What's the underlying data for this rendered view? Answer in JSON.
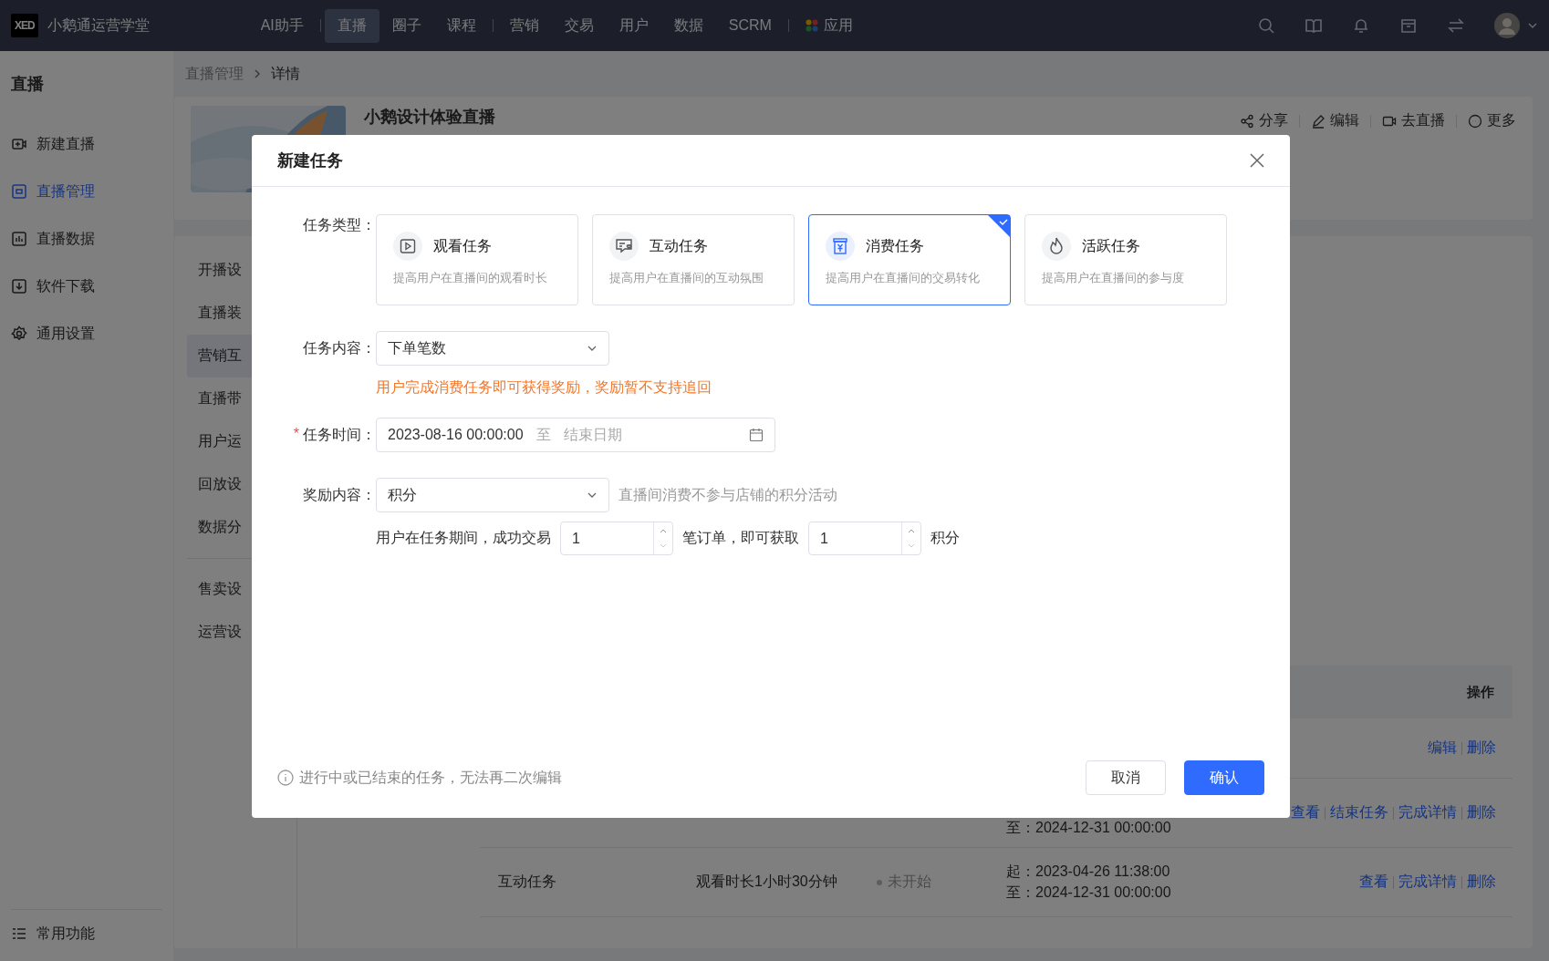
{
  "top_bar": {
    "logo": "XED",
    "brand": "小鹅通运营学堂",
    "nav_groups": [
      {
        "items": [
          {
            "label": "AI助手",
            "selected": false,
            "kind": "text"
          }
        ]
      },
      {
        "items": [
          {
            "label": "直播",
            "selected": true,
            "kind": "text"
          },
          {
            "label": "圈子",
            "selected": false,
            "kind": "text"
          },
          {
            "label": "课程",
            "selected": false,
            "kind": "text"
          }
        ]
      },
      {
        "items": [
          {
            "label": "营销",
            "selected": false,
            "kind": "text"
          },
          {
            "label": "交易",
            "selected": false,
            "kind": "text"
          },
          {
            "label": "用户",
            "selected": false,
            "kind": "text"
          },
          {
            "label": "数据",
            "selected": false,
            "kind": "text"
          },
          {
            "label": "SCRM",
            "selected": false,
            "kind": "text"
          }
        ]
      },
      {
        "items": [
          {
            "label": "应用",
            "selected": false,
            "kind": "apps"
          }
        ]
      }
    ]
  },
  "sidebar": {
    "title": "直播",
    "items": [
      {
        "label": "新建直播",
        "kind": "new",
        "selected": false
      },
      {
        "label": "直播管理",
        "kind": "manage",
        "selected": true
      },
      {
        "label": "直播数据",
        "kind": "data",
        "selected": false
      },
      {
        "label": "软件下载",
        "kind": "download",
        "selected": false
      },
      {
        "label": "通用设置",
        "kind": "settings",
        "selected": false
      }
    ],
    "footer": "常用功能"
  },
  "breadcrumb": [
    "直播管理",
    "详情"
  ],
  "live_header": {
    "title": "小鹅设计体验直播",
    "actions": [
      {
        "label": "分享",
        "kind": "share"
      },
      {
        "label": "编辑",
        "kind": "edit"
      },
      {
        "label": "去直播",
        "kind": "live"
      },
      {
        "label": "更多",
        "kind": "more"
      }
    ]
  },
  "submenu": {
    "groups": [
      {
        "items": [
          {
            "label": "开播设",
            "selected": false
          },
          {
            "label": "直播装",
            "selected": false
          },
          {
            "label": "营销互",
            "selected": true
          },
          {
            "label": "直播带",
            "selected": false
          },
          {
            "label": "用户运",
            "selected": false
          },
          {
            "label": "回放设",
            "selected": false
          },
          {
            "label": "数据分",
            "selected": false
          }
        ]
      },
      {
        "items": [
          {
            "label": "售卖设",
            "selected": false
          },
          {
            "label": "运营设",
            "selected": false
          }
        ]
      }
    ]
  },
  "table": {
    "header": "操作",
    "rows": [
      {
        "actions": [
          "编辑",
          "删除"
        ]
      },
      {
        "time": [
          "至：2024-12-31 00:00:00"
        ],
        "actions": [
          "查看",
          "结束任务",
          "完成详情",
          "删除"
        ]
      },
      {
        "type": "互动任务",
        "content": "观看时长1小时30分钟",
        "status": "未开始",
        "time": [
          "起：2023-04-26 11:38:00",
          "至：2024-12-31 00:00:00"
        ],
        "actions": [
          "查看",
          "完成详情",
          "删除"
        ]
      }
    ]
  },
  "modal": {
    "title": "新建任务",
    "task_type": {
      "label": "任务类型：",
      "options": [
        {
          "kind": "watch",
          "title": "观看任务",
          "desc": "提高用户在直播间的观看时长",
          "selected": false
        },
        {
          "kind": "interact",
          "title": "互动任务",
          "desc": "提高用户在直播间的互动氛围",
          "selected": false
        },
        {
          "kind": "consume",
          "title": "消费任务",
          "desc": "提高用户在直播间的交易转化",
          "selected": true
        },
        {
          "kind": "active",
          "title": "活跃任务",
          "desc": "提高用户在直播间的参与度",
          "selected": false
        }
      ]
    },
    "task_content": {
      "label": "任务内容：",
      "value": "下单笔数",
      "notice": "用户完成消费任务即可获得奖励，奖励暂不支持追回"
    },
    "task_time": {
      "label": "任务时间：",
      "required_mark": "*",
      "start": "2023-08-16 00:00:00",
      "separator": "至",
      "end_placeholder": "结束日期"
    },
    "reward": {
      "label": "奖励内容：",
      "value": "积分",
      "hint": "直播间消费不参与店铺的积分活动",
      "rule": {
        "text_1": "用户在任务期间，成功交易",
        "count": "1",
        "text_2": "笔订单，即可获取",
        "points": "1",
        "text_3": "积分"
      }
    },
    "footer_note": "进行中或已结束的任务，无法再二次编辑",
    "buttons": [
      {
        "label": "取消",
        "kind": "secondary"
      },
      {
        "label": "确认",
        "kind": "primary"
      }
    ]
  }
}
